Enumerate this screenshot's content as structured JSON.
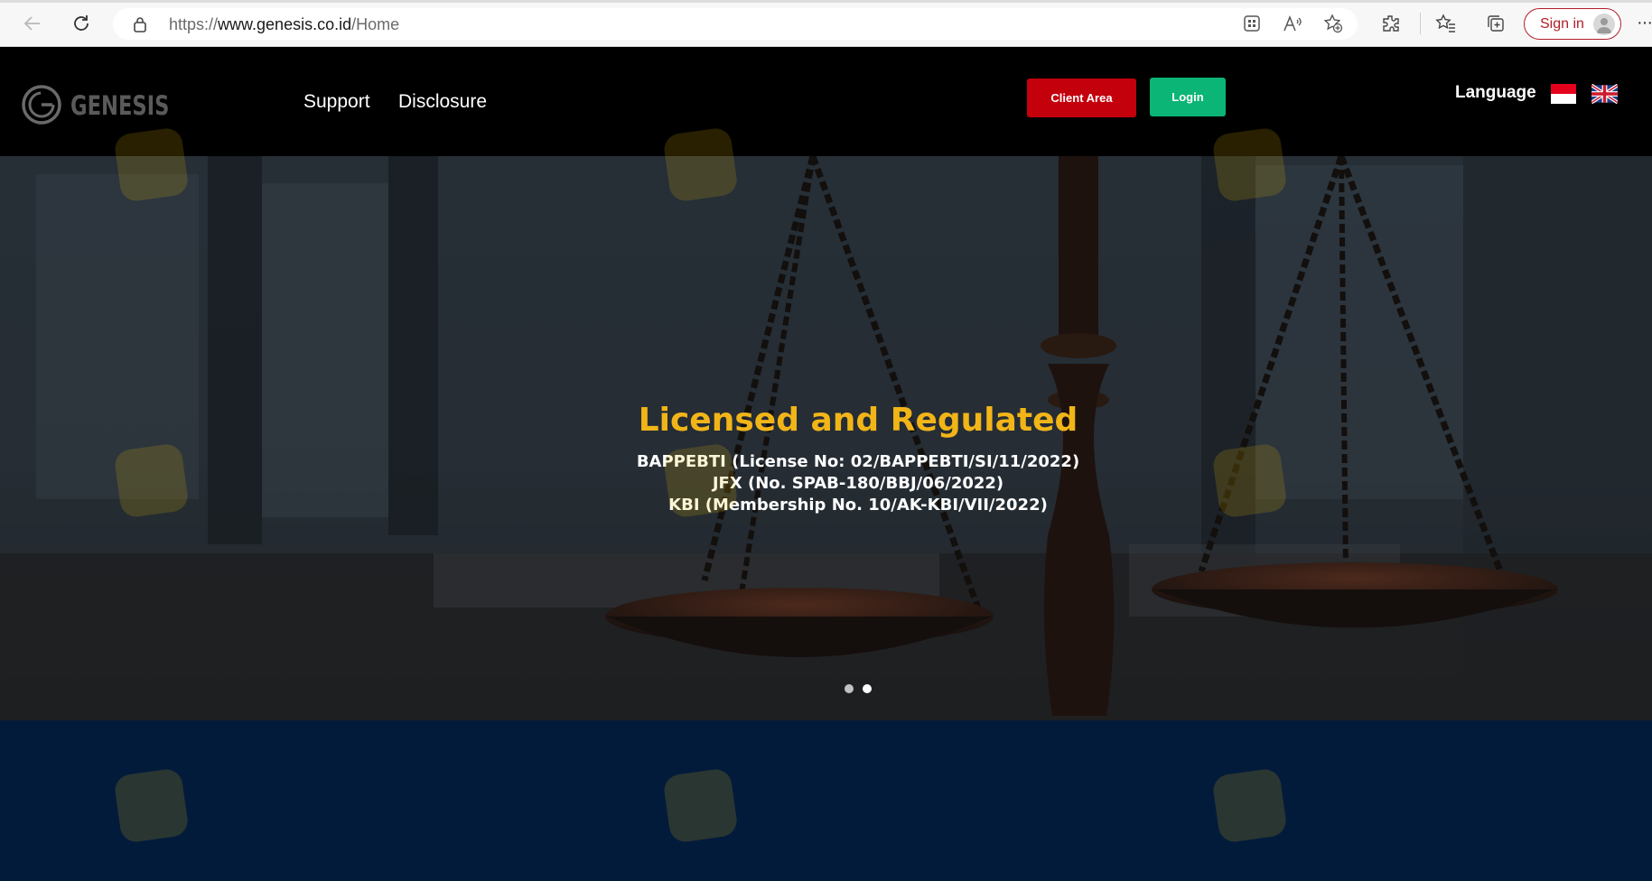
{
  "browser": {
    "url_protocol": "https://",
    "url_domain": "www.genesis.co.id",
    "url_path": "/Home",
    "sign_in_label": "Sign in",
    "more_label": "···"
  },
  "header": {
    "logo_text": "GENESIS",
    "nav": [
      "Support",
      "Disclosure"
    ],
    "client_area_label": "Client Area",
    "login_label": "Login",
    "language_label": "Language",
    "flags": [
      "indonesia-flag",
      "uk-flag"
    ]
  },
  "hero": {
    "title": "Licensed and Regulated",
    "lines": [
      "BAPPEBTI (License No: 02/BAPPEBTI/SI/11/2022)",
      "JFX (No. SPAB-180/BBJ/06/2022)",
      "KBI (Membership No. 10/AK-KBI/VII/2022)"
    ],
    "slide_count": 2,
    "active_slide": 2
  },
  "colors": {
    "client_area": "#c4000c",
    "login": "#0bb576",
    "hero_title": "#f2b518",
    "lower_section": "#031b3b",
    "sign_in": "#b21e2a"
  }
}
